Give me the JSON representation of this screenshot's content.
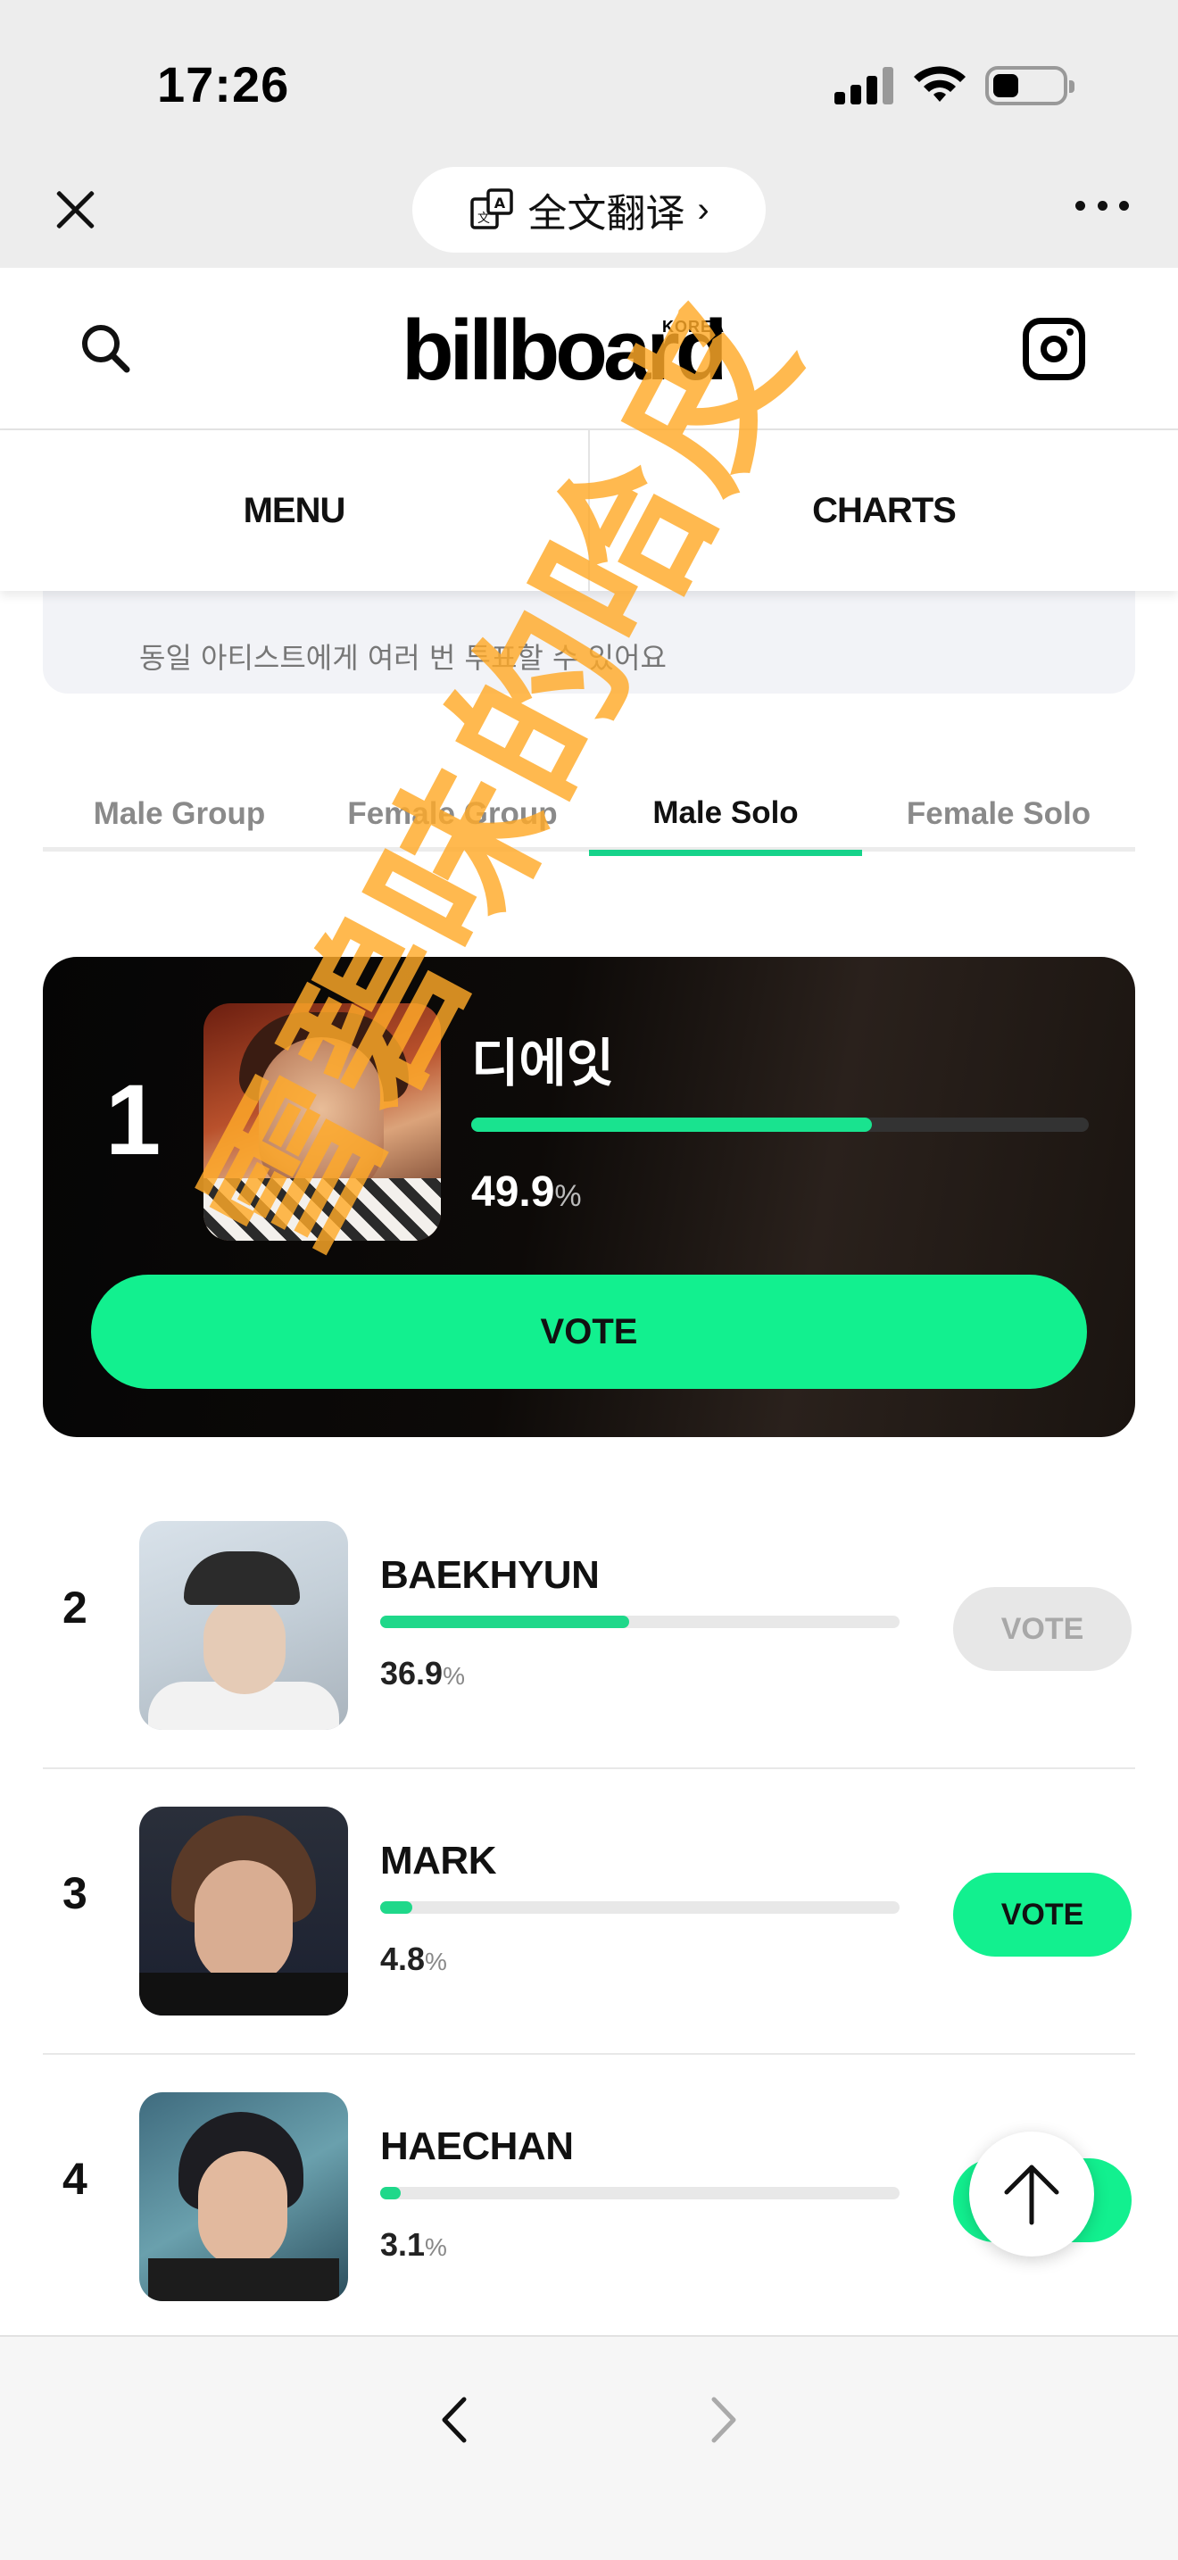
{
  "status_bar": {
    "time": "17:26"
  },
  "wechat_bar": {
    "translate_label": "全文翻译",
    "translate_chevron": "›"
  },
  "site": {
    "logo_word": "billboard",
    "logo_sub": "KOREA",
    "nav": {
      "menu": "MENU",
      "charts": "CHARTS"
    }
  },
  "notice": {
    "text": "동일 아티스트에게 여러 번 투표할 수 있어요"
  },
  "categories": {
    "tabs": [
      "Male Group",
      "Female Group",
      "Male Solo",
      "Female Solo"
    ],
    "active_index": 2
  },
  "ranking": {
    "top": {
      "rank": "1",
      "name": "디에잇",
      "percent": "49.9",
      "percent_value": 49.9,
      "vote_label": "VOTE"
    },
    "rows": [
      {
        "rank": "2",
        "name": "BAEKHYUN",
        "percent": "36.9",
        "percent_value": 36.9,
        "vote_label": "VOTE",
        "vote_enabled": false
      },
      {
        "rank": "3",
        "name": "MARK",
        "percent": "4.8",
        "percent_value": 4.8,
        "vote_label": "VOTE",
        "vote_enabled": true
      },
      {
        "rank": "4",
        "name": "HAECHAN",
        "percent": "3.1",
        "percent_value": 3.1,
        "vote_label": "VOTE",
        "vote_enabled": true
      }
    ],
    "percent_unit": "%"
  },
  "watermark": {
    "text": "雪碧味的哈皮"
  },
  "colors": {
    "accent": "#12f08f",
    "bar": "#1fd88a",
    "watermark": "#ffaa28"
  }
}
